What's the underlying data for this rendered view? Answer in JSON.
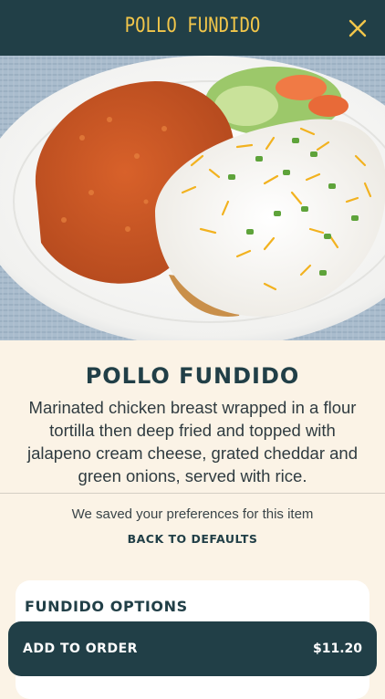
{
  "header": {
    "title": "POLLO FUNDIDO",
    "close_icon": "close-icon",
    "background": "#213f47",
    "accent": "#f2c64a"
  },
  "hero": {
    "image": "plate of pollo fundido with rice and salad"
  },
  "item": {
    "name": "POLLO FUNDIDO",
    "description": "Marinated chicken breast wrapped in a flour tortilla then deep fried and topped with jalapeno cream cheese, grated cheddar and green onions, served with rice."
  },
  "preferences": {
    "note": "We saved your preferences for this item",
    "reset_label": "BACK TO DEFAULTS"
  },
  "options": {
    "section_title": "FUNDIDO OPTIONS"
  },
  "order_bar": {
    "label": "ADD TO ORDER",
    "price": "$11.20"
  }
}
